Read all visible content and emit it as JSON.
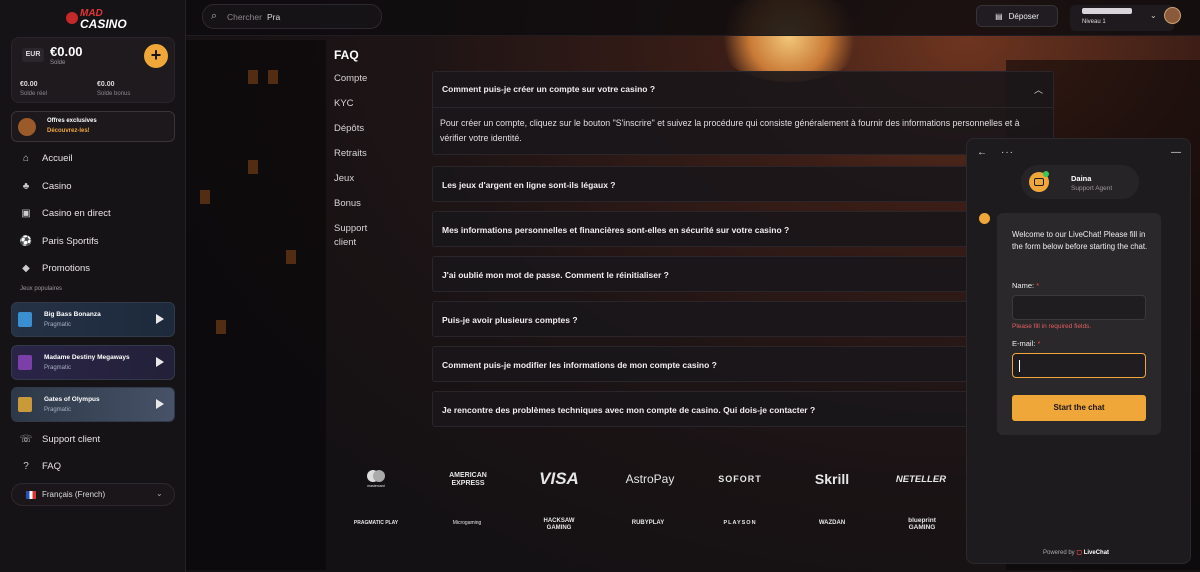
{
  "logo": {
    "line1": "MAD",
    "line2": "CASINO"
  },
  "search": {
    "placeholder": "Chercher",
    "value": "Pra"
  },
  "wallet": {
    "currency": "EUR",
    "balance": "€0.00",
    "balance_label": "Solde",
    "real_value": "€0.00",
    "real_label": "Solde réel",
    "bonus_value": "€0.00",
    "bonus_label": "Solde bonus"
  },
  "offer": {
    "title": "Offres exclusives",
    "subtitle": "Découvrez-les!"
  },
  "nav": [
    {
      "label": "Accueil",
      "icon": "home-icon"
    },
    {
      "label": "Casino",
      "icon": "casino-icon"
    },
    {
      "label": "Casino en direct",
      "icon": "live-casino-icon"
    },
    {
      "label": "Paris Sportifs",
      "icon": "soccer-ball-icon"
    },
    {
      "label": "Promotions",
      "icon": "diamond-icon"
    }
  ],
  "popular": {
    "title": "Jeux populaires",
    "games": [
      {
        "name": "Big Bass Bonanza",
        "provider": "Pragmatic"
      },
      {
        "name": "Madame Destiny Megaways",
        "provider": "Pragmatic"
      },
      {
        "name": "Gates of Olympus",
        "provider": "Pragmatic"
      }
    ]
  },
  "nav_bottom": [
    {
      "label": "Support client",
      "icon": "headset-icon"
    },
    {
      "label": "FAQ",
      "icon": "question-icon"
    }
  ],
  "language": {
    "label": "Français (French)"
  },
  "topbar": {
    "deposit_label": "Déposer",
    "level": "Niveau 1"
  },
  "faq": {
    "title": "FAQ",
    "categories": [
      "Compte",
      "KYC",
      "Dépôts",
      "Retraits",
      "Jeux",
      "Bonus",
      "Support client"
    ],
    "questions": [
      "Comment puis-je créer un compte sur votre casino ?",
      "Les jeux d'argent en ligne sont-ils légaux ?",
      "Mes informations personnelles et financières sont-elles en sécurité sur votre casino ?",
      "J'ai oublié mon mot de passe. Comment le réinitialiser ?",
      "Puis-je avoir plusieurs comptes ?",
      "Comment puis-je modifier les informations de mon compte casino ?",
      "Je rencontre des problèmes techniques avec mon compte de casino. Qui dois-je contacter ?"
    ],
    "answer": "Pour créer un compte, cliquez sur le bouton \"S'inscrire\" et suivez la procédure qui consiste généralement à fournir des informations personnelles et à vérifier votre identité."
  },
  "payments": {
    "row1": [
      "mastercard",
      "AMERICAN EXPRESS",
      "VISA",
      "AstroPay",
      "SOFORT",
      "Skrill",
      "NETELLER"
    ],
    "row2": [
      "PRAGMATIC PLAY",
      "Microgaming",
      "HACKSAW GAMING",
      "RUBYPLAY",
      "PLAYSON",
      "WAZDAN",
      "blueprint GAMING"
    ]
  },
  "chat": {
    "agent_name": "Daina",
    "agent_role": "Support Agent",
    "welcome": "Welcome to our LiveChat! Please fill in the form below before starting the chat.",
    "name_label": "Name:",
    "error": "Please fill in required fields.",
    "email_label": "E-mail:",
    "start_button": "Start the chat",
    "powered_prefix": "Powered by",
    "powered_brand": "LiveChat"
  },
  "colors": {
    "accent": "#f0a73a",
    "background": "#141114",
    "error": "#e06060"
  }
}
